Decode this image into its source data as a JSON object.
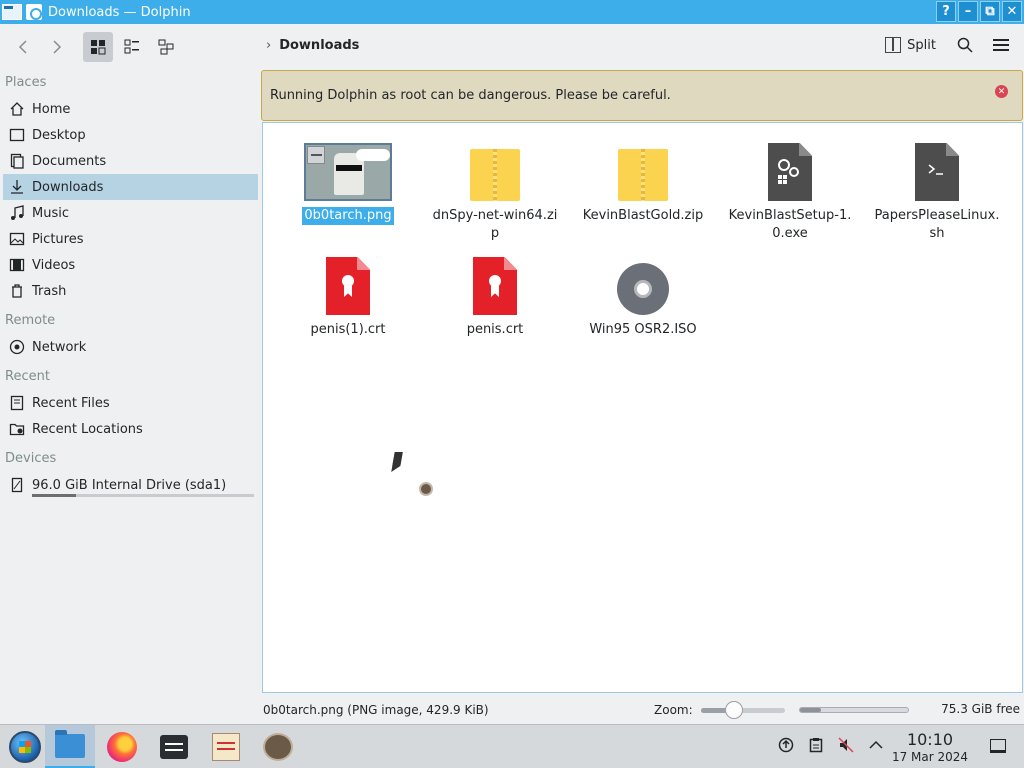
{
  "window": {
    "title": "Downloads — Dolphin",
    "buttons": {
      "help": "?",
      "minimize": "–",
      "maximize": "⧉",
      "close": "✕"
    }
  },
  "toolbar": {
    "breadcrumb": "Downloads",
    "split_label": "Split",
    "icons": [
      "back-icon",
      "forward-icon",
      "icons-view-icon",
      "compact-view-icon",
      "details-view-icon",
      "search-icon",
      "menu-icon"
    ]
  },
  "sidebar": {
    "places_title": "Places",
    "places": [
      {
        "label": "Home",
        "icon": "home-icon"
      },
      {
        "label": "Desktop",
        "icon": "desktop-icon"
      },
      {
        "label": "Documents",
        "icon": "documents-icon"
      },
      {
        "label": "Downloads",
        "icon": "downloads-icon",
        "selected": true
      },
      {
        "label": "Music",
        "icon": "music-icon"
      },
      {
        "label": "Pictures",
        "icon": "pictures-icon"
      },
      {
        "label": "Videos",
        "icon": "videos-icon"
      },
      {
        "label": "Trash",
        "icon": "trash-icon"
      }
    ],
    "remote_title": "Remote",
    "remote": [
      {
        "label": "Network",
        "icon": "network-icon"
      }
    ],
    "recent_title": "Recent",
    "recent": [
      {
        "label": "Recent Files",
        "icon": "recent-files-icon"
      },
      {
        "label": "Recent Locations",
        "icon": "recent-locations-icon"
      }
    ],
    "devices_title": "Devices",
    "devices": [
      {
        "label": "96.0 GiB Internal Drive (sda1)",
        "icon": "drive-icon",
        "usage_fraction": 0.2
      }
    ]
  },
  "banner": {
    "message": "Running Dolphin as root can be dangerous. Please be careful.",
    "color": "#dfd9c0"
  },
  "files": [
    {
      "name": "0b0tarch.png",
      "type": "image",
      "selected": true
    },
    {
      "name": "dnSpy-net-win64.zip",
      "type": "zip"
    },
    {
      "name": "KevinBlastGold.zip",
      "type": "zip"
    },
    {
      "name": "KevinBlastSetup-1.0.exe",
      "type": "exe"
    },
    {
      "name": "PapersPleaseLinux.sh",
      "type": "script"
    },
    {
      "name": "penis(1).crt",
      "type": "certificate"
    },
    {
      "name": "penis.crt",
      "type": "certificate"
    },
    {
      "name": "Win95 OSR2.ISO",
      "type": "disc-image"
    }
  ],
  "statusbar": {
    "info": "0b0tarch.png (PNG image, 429.9 KiB)",
    "zoom_label": "Zoom:",
    "zoom_fraction": 0.4,
    "used_fraction": 0.2,
    "free_space": "75.3 GiB free"
  },
  "taskbar": {
    "apps": [
      "start-menu",
      "dolphin",
      "firefox",
      "konsole",
      "text-editor",
      "gimp"
    ],
    "active": "dolphin",
    "clock_time": "10:10",
    "clock_date": "17 Mar 2024",
    "tray_icons": [
      "network-icon",
      "clipboard-icon",
      "volume-muted-icon",
      "tray-expand-icon"
    ]
  },
  "colors": {
    "accent": "#3daee9",
    "selection": "#b6d3e4",
    "warning_border": "#c9a84a",
    "close_red": "#da4453"
  }
}
